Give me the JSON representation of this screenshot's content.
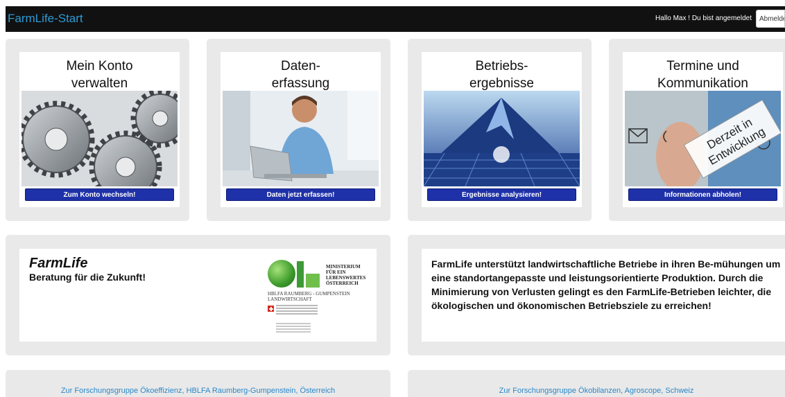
{
  "navbar": {
    "brand": "FarmLife-Start",
    "greeting": "Hallo Max ! Du bist angemeldet",
    "logout_label": "Abmelden"
  },
  "tiles": [
    {
      "title": "Mein Konto\nverwalten",
      "button": "Zum Konto wechseln!"
    },
    {
      "title": "Daten-\nerfassung",
      "button": "Daten jetzt erfassen!"
    },
    {
      "title": "Betriebs-\nergebnisse",
      "button": "Ergebnisse analysieren!"
    },
    {
      "title": "Termine und\nKommunikation",
      "button": "Informationen abholen!",
      "stamp": "Derzeit in\nEntwicklung"
    }
  ],
  "brand_panel": {
    "title": "FarmLife",
    "subtitle": "Beratung für die Zukunft!",
    "logo": {
      "ministry": "MINISTERIUM\nFÜR EIN\nLEBENSWERTES\nÖSTERREICH",
      "institute": "HBLFA RAUMBERG - GUMPENSTEIN\nLANDWIRTSCHAFT"
    }
  },
  "description": "FarmLife unterstützt landwirtschaftliche Betriebe in ihren Be-mühungen um eine standortangepasste und leistungsorientierte Produktion. Durch die Minimierung von Verlusten gelingt es den FarmLife-Betrieben leichter, die ökologischen und ökonomischen Betriebsziele zu erreichen!",
  "links": [
    "Zur Forschungsgruppe Ökoeffizienz, HBLFA Raumberg-Gumpenstein, Österreich",
    "Zur Forschungsgruppe Ökobilanzen, Agroscope, Schweiz"
  ],
  "colors": {
    "navbar_bg": "#111111",
    "brand": "#2e9ad6",
    "tile_button": "#1f31a8",
    "panel_bg": "#e9e9e9",
    "link": "#2b87c8"
  },
  "icons": [
    "gears-image",
    "person-laptop-image",
    "mountain-grid-image",
    "communication-image"
  ]
}
